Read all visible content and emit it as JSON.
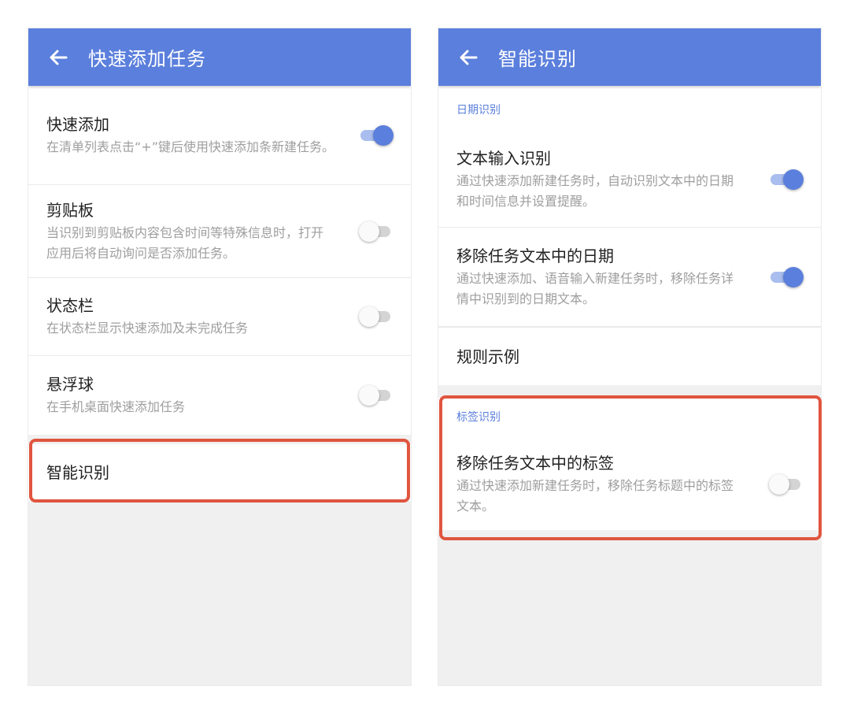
{
  "left_screen": {
    "title": "快速添加任务",
    "back_icon": "arrow-left-icon",
    "items": [
      {
        "title": "快速添加",
        "desc": "在清单列表点击“+”键后使用快速添加条新建任务。",
        "toggle": true
      },
      {
        "title": "剪贴板",
        "desc": "当识别到剪贴板内容包含时间等特殊信息时，打开应用后将自动询问是否添加任务。",
        "toggle": false
      },
      {
        "title": "状态栏",
        "desc": "在状态栏显示快速添加及未完成任务",
        "toggle": false
      },
      {
        "title": "悬浮球",
        "desc": "在手机桌面快速添加任务",
        "toggle": false
      },
      {
        "title": "智能识别"
      }
    ]
  },
  "right_screen": {
    "title": "智能识别",
    "back_icon": "arrow-left-icon",
    "date_section": {
      "header": "日期识别",
      "items": [
        {
          "title": "文本输入识别",
          "desc": "通过快速添加新建任务时，自动识别文本中的日期和时间信息并设置提醒。",
          "toggle": true
        },
        {
          "title": "移除任务文本中的日期",
          "desc": "通过快速添加、语音输入新建任务时，移除任务详情中识别到的日期文本。",
          "toggle": true
        },
        {
          "title": "规则示例"
        }
      ]
    },
    "tag_section": {
      "header": "标签识别",
      "items": [
        {
          "title": "移除任务文本中的标签",
          "desc": "通过快速添加新建任务时，移除任务标题中的标签文本。",
          "toggle": false
        }
      ]
    }
  },
  "colors": {
    "accent": "#5b7fdc",
    "highlight_border": "#e0553f",
    "background": "#f0f0f0"
  }
}
